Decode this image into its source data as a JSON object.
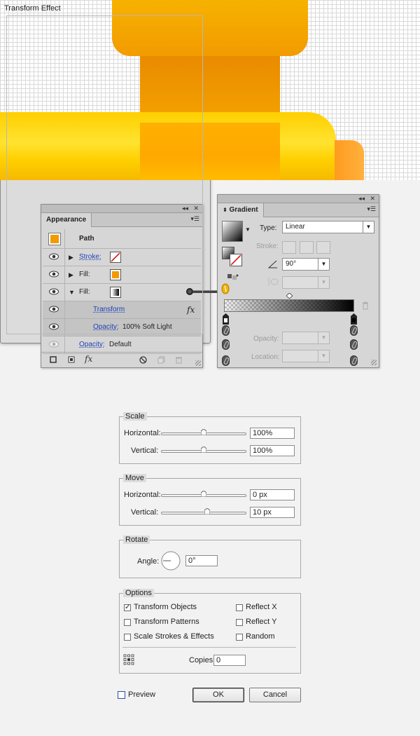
{
  "colors": {
    "accent_orange": "#f39a00",
    "link_blue": "#1f3fb7",
    "stroke_none_red": "#d51d1d"
  },
  "appearance": {
    "tab": "Appearance",
    "bar_collapse": "◂◂",
    "bar_close": "✕",
    "menu": "▾☰",
    "path_label": "Path",
    "rows": [
      {
        "label": "Stroke:"
      },
      {
        "label": "Fill:"
      },
      {
        "label": "Fill:"
      },
      {
        "label": "Transform",
        "fx": "fx"
      },
      {
        "label": "Opacity:",
        "value": "100% Soft Light"
      },
      {
        "label": "Opacity:",
        "value": "Default"
      }
    ],
    "bottom_fx": "fx"
  },
  "gradient": {
    "tab": "Gradient",
    "type_label": "Type:",
    "type_value": "Linear",
    "stroke_label": "Stroke:",
    "angle_value": "90°",
    "opacity_label": "Opacity:",
    "location_label": "Location:"
  },
  "dialog": {
    "title": "Transform Effect",
    "scale": {
      "title": "Scale",
      "horizontal_label": "Horizontal:",
      "horizontal_value": "100%",
      "vertical_label": "Vertical:",
      "vertical_value": "100%"
    },
    "move": {
      "title": "Move",
      "horizontal_label": "Horizontal:",
      "horizontal_value": "0 px",
      "vertical_label": "Vertical:",
      "vertical_value": "10 px"
    },
    "rotate": {
      "title": "Rotate",
      "angle_label": "Angle:",
      "angle_value": "0°"
    },
    "options": {
      "title": "Options",
      "transform_objects": "Transform Objects",
      "transform_patterns": "Transform Patterns",
      "scale_strokes": "Scale Strokes & Effects",
      "reflect_x": "Reflect X",
      "reflect_y": "Reflect Y",
      "random": "Random",
      "copies_label": "Copies",
      "copies_value": "0",
      "checked_mark": "✓"
    },
    "preview_label": "Preview",
    "ok_label": "OK",
    "cancel_label": "Cancel"
  }
}
